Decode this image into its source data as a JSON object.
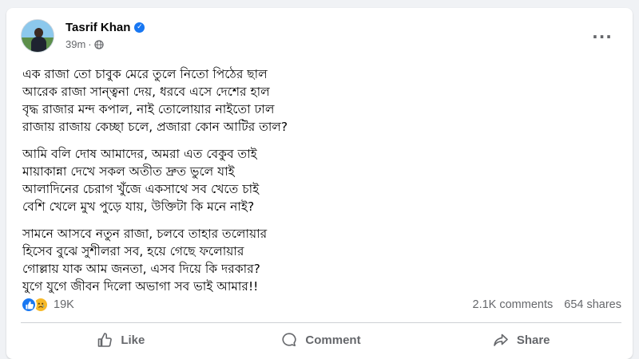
{
  "post": {
    "author": "Tasrif Khan",
    "time": "39m",
    "separator": "·",
    "more_label": "···",
    "stanzas": [
      [
        "এক রাজা তো চাবুক মেরে তুলে নিতো পিঠের ছাল",
        "আরেক রাজা সান্ত্বনা দেয়, ধরবে এসে দেশের হাল",
        "বৃদ্ধ রাজার মন্দ কপাল, নাই তোলোয়ার নাইতো ঢাল",
        "রাজায় রাজায় কেচ্ছা চলে, প্রজারা কোন আটির তাল?"
      ],
      [
        "আমি বলি দোষ আমাদের, অমরা এত বেকুব তাই",
        "মায়াকান্না দেখে সকল অতীত দ্রুত ভুলে যাই",
        "আলাদিনের চেরাগ খুঁজে একসাথে সব খেতে চাই",
        "বেশি খেলে মুখ পুড়ে যায়, উক্তিটা কি মনে নাই?"
      ],
      [
        "সামনে আসবে নতুন রাজা, চলবে তাহার তলোয়ার",
        "হিসেব বুঝে সুশীলরা সব, হয়ে গেছে ফলোয়ার",
        "গোল্লায় যাক আম জনতা, এসব দিয়ে কি দরকার?",
        "যুগে যুগে জীবন দিলো অভাগা সব ভাই আমার!!"
      ]
    ]
  },
  "stats": {
    "reaction_count": "19K",
    "comments": "2.1K comments",
    "shares": "654 shares"
  },
  "actions": {
    "like": "Like",
    "comment": "Comment",
    "share": "Share"
  },
  "icons": {
    "verified": "verified-badge-icon",
    "privacy": "globe-icon",
    "reactions": [
      "like-reaction-icon",
      "sad-reaction-icon"
    ]
  },
  "colors": {
    "accent": "#1877f2",
    "secondary_text": "#65676b",
    "background": "#f0f2f5"
  }
}
